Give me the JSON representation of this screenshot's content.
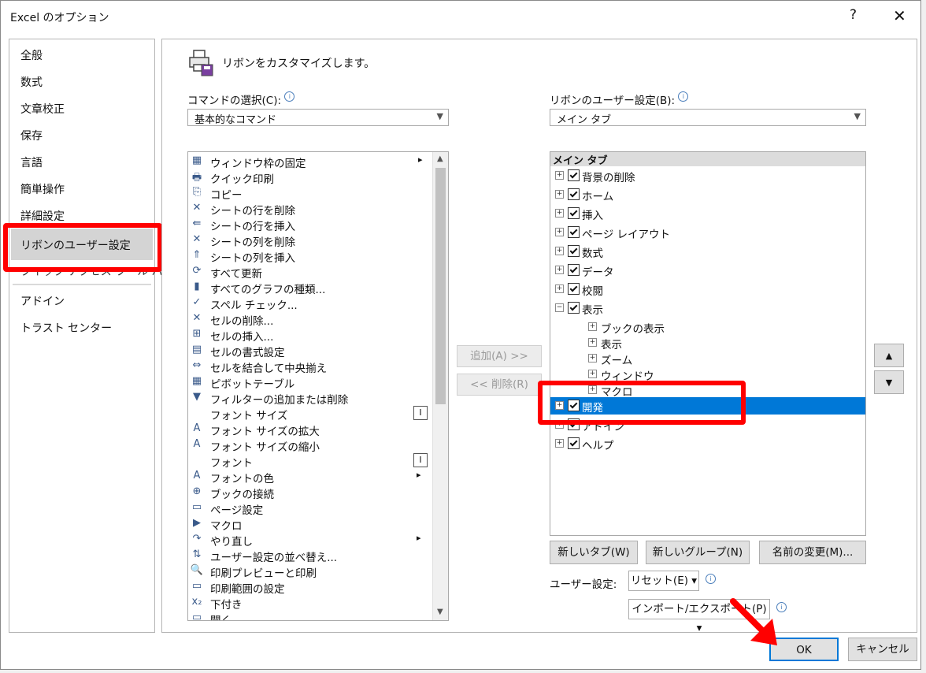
{
  "window": {
    "title": "Excel のオプション",
    "help": "?",
    "close": "✕"
  },
  "nav": {
    "items": [
      {
        "label": "全般"
      },
      {
        "label": "数式"
      },
      {
        "label": "文章校正"
      },
      {
        "label": "保存"
      },
      {
        "label": "言語"
      },
      {
        "label": "簡単操作"
      },
      {
        "label": "詳細設定"
      },
      {
        "label": "リボンのユーザー設定"
      },
      {
        "label": "クイック アクセス ツール バー"
      },
      {
        "label": "アドイン"
      },
      {
        "label": "トラスト センター"
      }
    ],
    "selected_index": 7
  },
  "header": {
    "title": "リボンをカスタマイズします。",
    "icon": "customize-ribbon-icon"
  },
  "commands": {
    "label": "コマンドの選択(C):",
    "combo_value": "基本的なコマンド",
    "items": [
      {
        "label": "ウィンドウ枠の固定",
        "icon": "▦",
        "submenu": "▸"
      },
      {
        "label": "クイック印刷",
        "icon": "🖶"
      },
      {
        "label": "コピー",
        "icon": "⎘"
      },
      {
        "label": "シートの行を削除",
        "icon": "✕"
      },
      {
        "label": "シートの行を挿入",
        "icon": "⇚"
      },
      {
        "label": "シートの列を削除",
        "icon": "✕"
      },
      {
        "label": "シートの列を挿入",
        "icon": "⇑"
      },
      {
        "label": "すべて更新",
        "icon": "⟳"
      },
      {
        "label": "すべてのグラフの種類...",
        "icon": "▮"
      },
      {
        "label": "スペル チェック...",
        "icon": "✓"
      },
      {
        "label": "セルの削除...",
        "icon": "✕"
      },
      {
        "label": "セルの挿入...",
        "icon": "⊞"
      },
      {
        "label": "セルの書式設定",
        "icon": "▤"
      },
      {
        "label": "セルを結合して中央揃え",
        "icon": "⇔"
      },
      {
        "label": "ピボットテーブル",
        "icon": "▦"
      },
      {
        "label": "フィルターの追加または削除",
        "icon": "▼"
      },
      {
        "label": "フォント サイズ",
        "icon": "",
        "side": "I"
      },
      {
        "label": "フォント サイズの拡大",
        "icon": "A"
      },
      {
        "label": "フォント サイズの縮小",
        "icon": "A"
      },
      {
        "label": "フォント",
        "icon": "",
        "side": "I"
      },
      {
        "label": "フォントの色",
        "icon": "A",
        "submenu": "▸"
      },
      {
        "label": "ブックの接続",
        "icon": "⊕"
      },
      {
        "label": "ページ設定",
        "icon": "▭"
      },
      {
        "label": "マクロ",
        "icon": "▶"
      },
      {
        "label": "やり直し",
        "icon": "↷",
        "submenu": "▸"
      },
      {
        "label": "ユーザー設定の並べ替え...",
        "icon": "⇅"
      },
      {
        "label": "印刷プレビューと印刷",
        "icon": "🔍"
      },
      {
        "label": "印刷範囲の設定",
        "icon": "▭"
      },
      {
        "label": "下付き",
        "icon": "x₂"
      },
      {
        "label": "開く",
        "icon": "▭"
      }
    ]
  },
  "mid_buttons": {
    "add": "追加(A) >>",
    "remove": "<< 削除(R)"
  },
  "ribbon": {
    "label": "リボンのユーザー設定(B):",
    "combo_value": "メイン タブ",
    "tree_header": "メイン タブ",
    "tabs": [
      {
        "label": "背景の削除"
      },
      {
        "label": "ホーム"
      },
      {
        "label": "挿入"
      },
      {
        "label": "ページ レイアウト"
      },
      {
        "label": "数式"
      },
      {
        "label": "データ"
      },
      {
        "label": "校閲"
      },
      {
        "label": "表示",
        "expanded": true
      }
    ],
    "groups": [
      {
        "label": "ブックの表示"
      },
      {
        "label": "表示"
      },
      {
        "label": "ズーム"
      },
      {
        "label": "ウィンドウ"
      },
      {
        "label": "マクロ"
      }
    ],
    "after_tabs": [
      {
        "label": "開発",
        "selected": true
      },
      {
        "label": "アドイン"
      },
      {
        "label": "ヘルプ"
      }
    ]
  },
  "bottom_buttons": {
    "new_tab": "新しいタブ(W)",
    "new_group": "新しいグループ(N)",
    "rename": "名前の変更(M)..."
  },
  "user_settings": {
    "label": "ユーザー設定:",
    "reset": "リセット(E) ▾",
    "import_export": "インポート/エクスポート(P) ▾"
  },
  "dialog_buttons": {
    "ok": "OK",
    "cancel": "キャンセル"
  },
  "colors": {
    "selection": "#0078d7",
    "highlight": "#ff0000",
    "nav_selected": "#d4d4d4"
  }
}
